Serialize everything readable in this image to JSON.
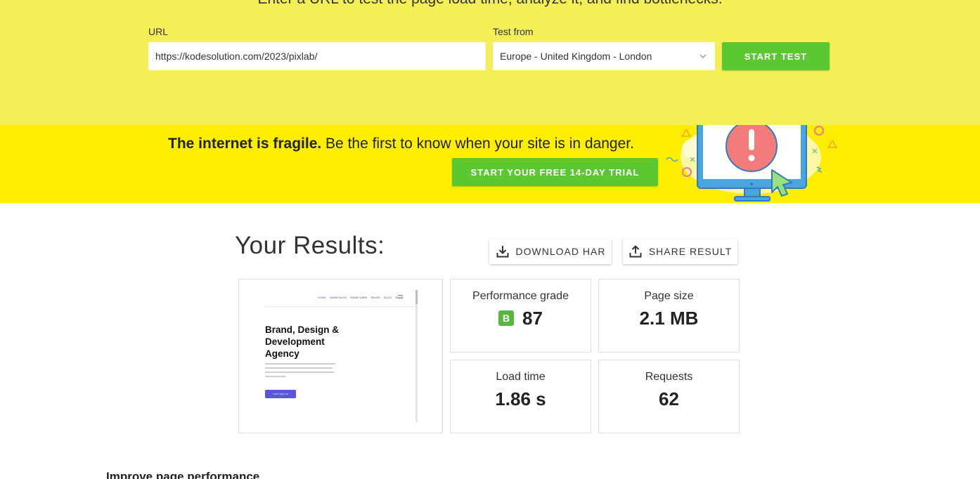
{
  "hero": {
    "tagline": "Enter a URL to test the page load time, analyze it, and find bottlenecks.",
    "url_label": "URL",
    "url_value": "https://kodesolution.com/2023/pixlab/",
    "test_from_label": "Test from",
    "test_from_selected": "Europe - United Kingdom - London",
    "start_test_label": "START TEST"
  },
  "banner": {
    "bold_text": "The internet is fragile.",
    "rest_text": " Be the first to know when your site is in danger.",
    "trial_label": "START YOUR FREE 14-DAY TRIAL"
  },
  "results": {
    "title": "Your Results:",
    "download_label": "DOWNLOAD HAR",
    "share_label": "SHARE RESULT",
    "screenshot": {
      "nav": [
        "HOME",
        "HOME BLOG",
        "HOME DARK",
        "PAGES",
        "BLOG",
        "SHOP"
      ],
      "heading": "Brand, Design & Development Agency",
      "cta": "LET'S TALK US"
    },
    "metrics": {
      "performance": {
        "label": "Performance grade",
        "grade": "B",
        "value": "87"
      },
      "page_size": {
        "label": "Page size",
        "value": "2.1 MB"
      },
      "load_time": {
        "label": "Load time",
        "value": "1.86 s"
      },
      "requests": {
        "label": "Requests",
        "value": "62"
      }
    }
  },
  "improve": {
    "title": "Improve page performance"
  },
  "colors": {
    "hero_bg": "#f4ef55",
    "banner_bg": "#fdee00",
    "accent_green": "#5bc832",
    "grade_green": "#58b73f"
  },
  "icons": {
    "select_chevron": "chevron-down-icon",
    "download": "download-icon",
    "share": "share-icon",
    "banner": "monitor-alert-illustration"
  }
}
